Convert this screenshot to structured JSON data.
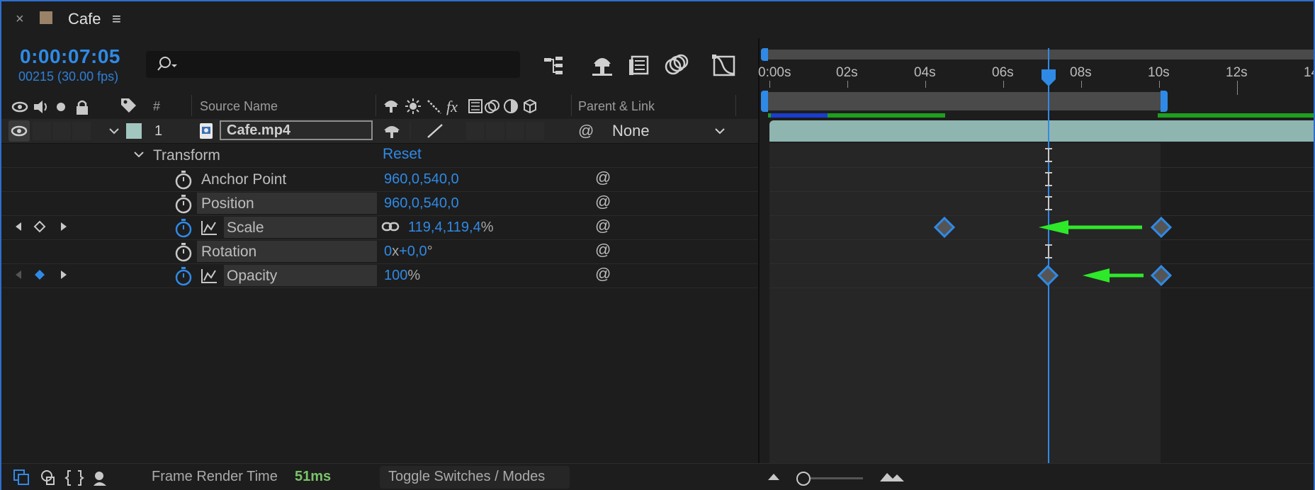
{
  "tab": {
    "title": "Cafe",
    "close": "×",
    "menu": "≡"
  },
  "time": {
    "timecode": "0:00:07:05",
    "frames": "00215 (30.00 fps)"
  },
  "search": {
    "placeholder": ""
  },
  "headers": {
    "num": "#",
    "source_name": "Source Name",
    "parent_link": "Parent & Link",
    "fx": "fx"
  },
  "layer": {
    "number": "1",
    "name": "Cafe.mp4",
    "parent": "None",
    "label_color": "#a2c6c0"
  },
  "transform": {
    "label": "Transform",
    "reset": "Reset"
  },
  "properties": [
    {
      "name": "Anchor Point",
      "value": "960,0,540,0"
    },
    {
      "name": "Position",
      "value": "960,0,540,0"
    },
    {
      "name": "Scale",
      "value": "119,4,119,4",
      "unit": "%"
    },
    {
      "name": "Rotation",
      "value_a": "0",
      "value_sep": "x",
      "value_b": "+0,0",
      "unit": "°"
    },
    {
      "name": "Opacity",
      "value": "100",
      "unit": "%"
    }
  ],
  "ruler": [
    "0:00s",
    "02s",
    "04s",
    "06s",
    "08s",
    "10s",
    "12s",
    "14"
  ],
  "footer": {
    "render_label": "Frame Render Time",
    "render_value": "51ms",
    "toggle": "Toggle Switches / Modes"
  },
  "colors": {
    "accent": "#2f8ae6",
    "arrow": "#2ee82a",
    "layer_bar": "#8fb5b0"
  }
}
